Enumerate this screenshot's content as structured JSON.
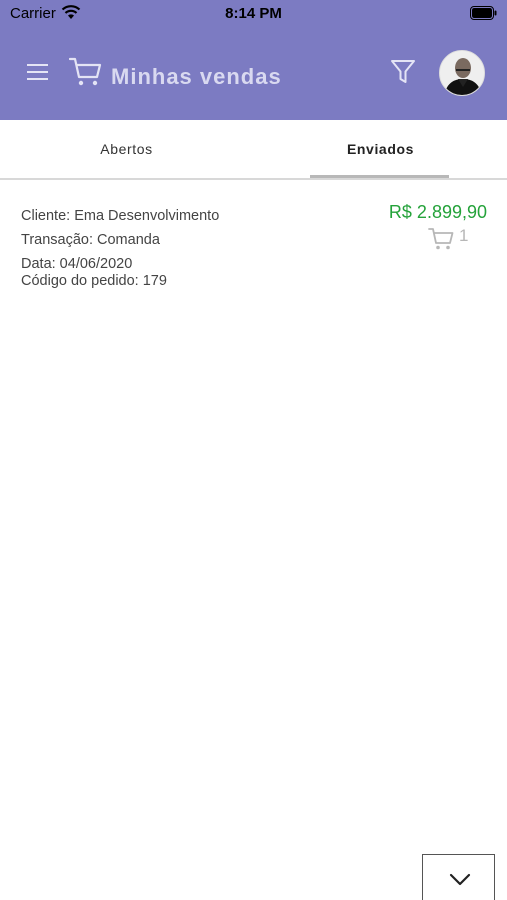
{
  "status_bar": {
    "carrier": "Carrier",
    "time": "8:14 PM"
  },
  "header": {
    "title": "Minhas vendas",
    "menu_icon": "hamburger-icon",
    "title_icon": "cart-icon",
    "filter_icon": "filter-icon",
    "background_color": "#7c7bc2"
  },
  "tabs": [
    {
      "label": "Abertos",
      "selected": false
    },
    {
      "label": "Enviados",
      "selected": true
    }
  ],
  "orders": [
    {
      "client": "Cliente: Ema Desenvolvimento",
      "transaction": "Transação: Comanda",
      "date": "Data: 04/06/2020",
      "order_code": "Código do pedido: 179",
      "total": "R$ 2.899,90",
      "items_count": "1",
      "price_color": "#24a23a"
    }
  ],
  "scroll_button_icon": "chevron-down-icon"
}
